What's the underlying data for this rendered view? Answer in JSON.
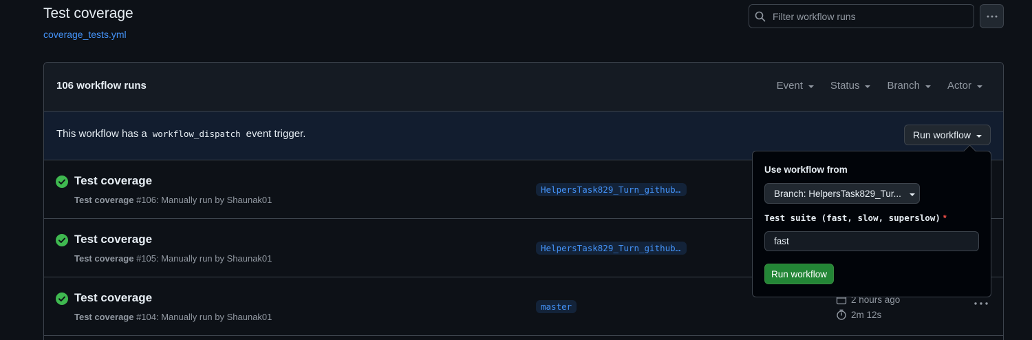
{
  "header": {
    "title": "Test coverage",
    "file_link": "coverage_tests.yml"
  },
  "search": {
    "placeholder": "Filter workflow runs"
  },
  "box": {
    "runs_count": "106 workflow runs",
    "filters": [
      "Event",
      "Status",
      "Branch",
      "Actor"
    ]
  },
  "dispatch": {
    "text_before": "This workflow has a",
    "code": "workflow_dispatch",
    "text_after": "event trigger.",
    "run_button": "Run workflow"
  },
  "runs": [
    {
      "title": "Test coverage",
      "sub_workflow": "Test coverage",
      "sub_detail": " #106: Manually run by Shaunak01",
      "branch": "HelpersTask829_Turn_github_actions"
    },
    {
      "title": "Test coverage",
      "sub_workflow": "Test coverage",
      "sub_detail": " #105: Manually run by Shaunak01",
      "branch": "HelpersTask829_Turn_github_actions"
    },
    {
      "title": "Test coverage",
      "sub_workflow": "Test coverage",
      "sub_detail": " #104: Manually run by Shaunak01",
      "branch": "master",
      "time_ago": "2 hours ago",
      "duration": "2m 12s"
    }
  ],
  "popover": {
    "title": "Use workflow from",
    "branch_select": "Branch: HelpersTask829_Tur...",
    "suite_label": "Test suite (fast, slow, superslow)",
    "required_mark": "*",
    "suite_value": "fast",
    "submit": "Run workflow"
  },
  "colors": {
    "accent_link": "#4493f8",
    "success": "#3fb950",
    "primary_button": "#238636",
    "required": "#f85149"
  }
}
